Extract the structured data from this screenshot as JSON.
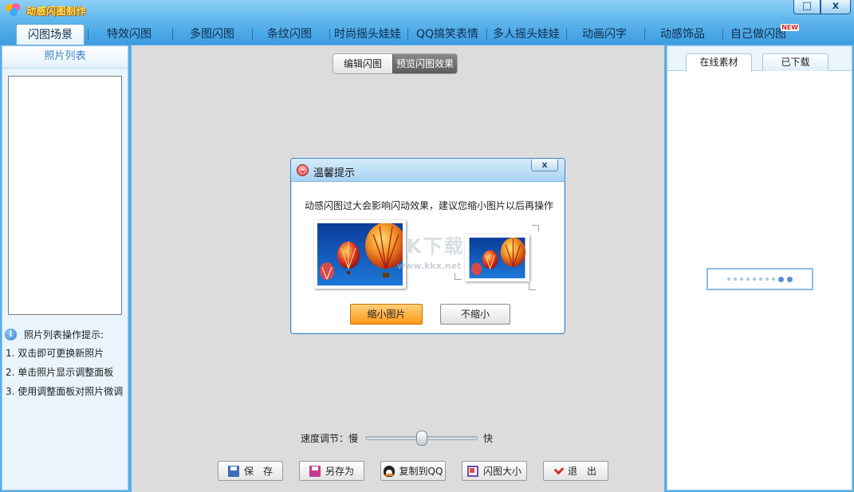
{
  "app": {
    "title": "动感闪图制作",
    "window_buttons": {
      "maximize": "□",
      "close": "x"
    }
  },
  "nav": {
    "tabs": [
      {
        "label": "闪图场景",
        "active": true
      },
      {
        "label": "特效闪图"
      },
      {
        "label": "多图闪图"
      },
      {
        "label": "条纹闪图"
      },
      {
        "label": "时尚摇头娃娃"
      },
      {
        "label": "QQ搞笑表情"
      },
      {
        "label": "多人摇头娃娃"
      },
      {
        "label": "动画闪字"
      },
      {
        "label": "动感饰品"
      },
      {
        "label": "自己做闪图",
        "badge": "NEW"
      }
    ]
  },
  "left": {
    "header": "照片列表",
    "tips_title": "照片列表操作提示:",
    "tips": [
      "1. 双击即可更换新照片",
      "2. 单击照片显示调整面板",
      "3. 使用调整面板对照片微调"
    ]
  },
  "center": {
    "segments": {
      "edit": "编辑闪图",
      "preview": "预览闪图效果"
    },
    "dialog": {
      "title": "温馨提示",
      "close": "x",
      "message": "动感闪图过大会影响闪动效果，建议您缩小图片以后再操作",
      "watermark": "K下载",
      "watermark_url": "www.kkx.net",
      "btn_shrink": "缩小图片",
      "btn_no_shrink": "不缩小"
    },
    "speed": {
      "label": "速度调节：慢",
      "fast": "快",
      "level": 0.5
    },
    "buttons": {
      "save": "保　存",
      "save_as": "另存为",
      "copy_qq": "复制到QQ",
      "size": "闪图大小",
      "exit": "退　出"
    }
  },
  "right": {
    "tabs": {
      "online": "在线素材",
      "downloaded": "已下载"
    }
  },
  "colors": {
    "title_bar": "#5fb6ec",
    "accent_orange": "#ff9a1a",
    "panel_bg": "#e9f4fc"
  }
}
